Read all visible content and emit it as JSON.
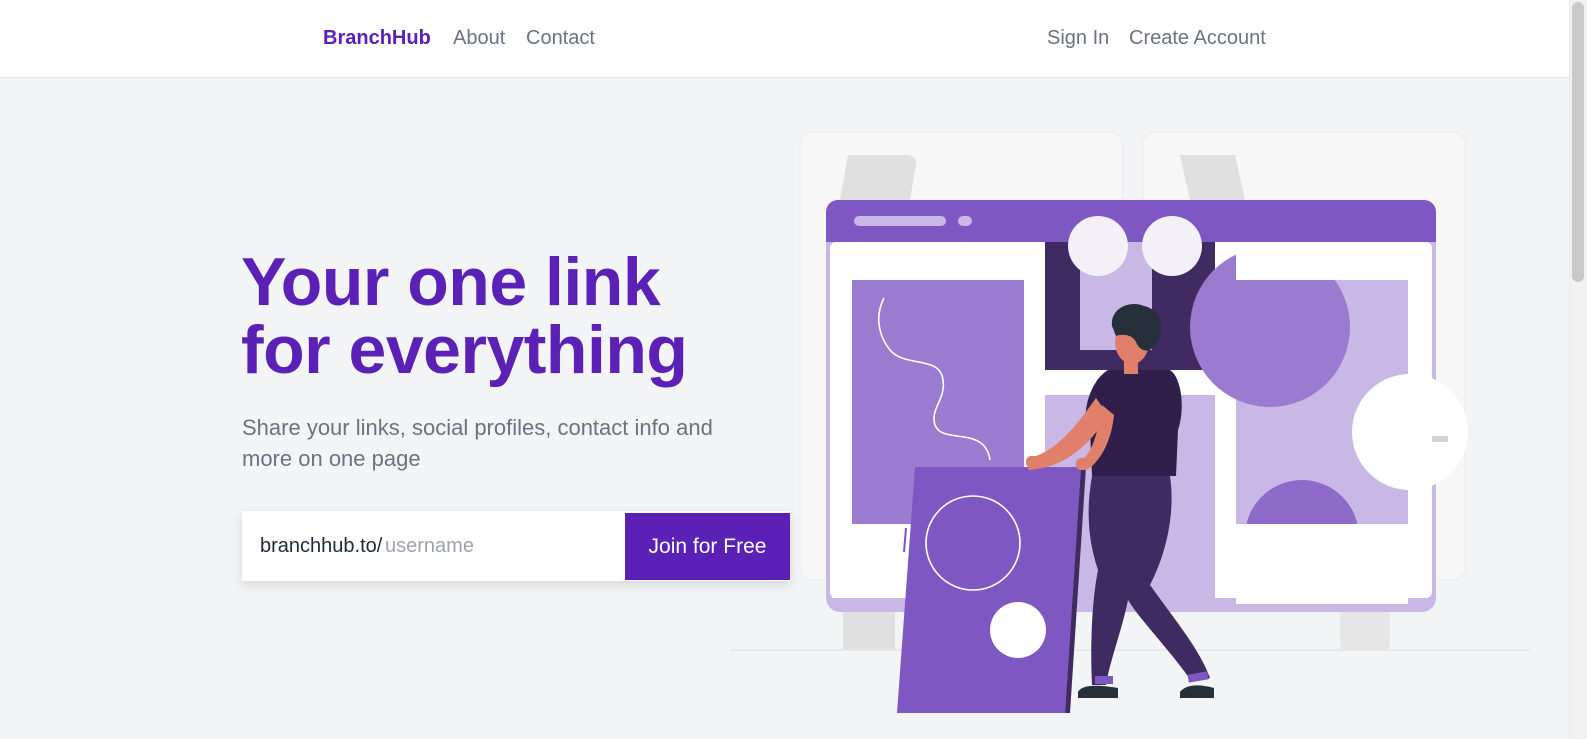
{
  "nav": {
    "brand": "BranchHub",
    "links": [
      "About",
      "Contact"
    ],
    "right_links": [
      "Sign In",
      "Create Account"
    ]
  },
  "hero": {
    "title_line1": "Your one link",
    "title_line2": "for everything",
    "subtitle": "Share your links, social profiles, contact info and more on one page"
  },
  "signup": {
    "prefix": "branchhub.to/",
    "placeholder": "username",
    "value": "",
    "button_label": "Join for Free"
  },
  "illustration": {
    "name": "person-arranging-profile-page-illustration",
    "colors": {
      "primary": "#7e57c2",
      "dark": "#3f2a62",
      "light": "#c9b8e6",
      "mid": "#9a7bd0"
    }
  }
}
